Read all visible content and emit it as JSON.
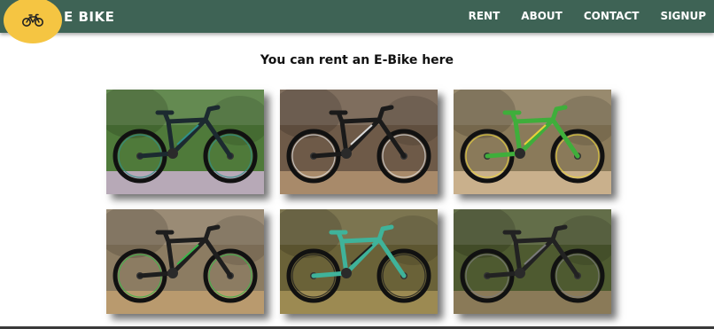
{
  "brand": {
    "name": "E BIKE",
    "logo_icon": "bicycle-icon",
    "logo_color": "#f5c542"
  },
  "nav": {
    "items": [
      {
        "label": "RENT"
      },
      {
        "label": "ABOUT"
      },
      {
        "label": "CONTACT"
      },
      {
        "label": "SIGNUP"
      }
    ],
    "background": "#3e6355"
  },
  "main": {
    "heading": "You can rent an E-Bike here"
  },
  "gallery": {
    "items": [
      {
        "name": "black-teal-mountain-bike-photo",
        "frame": "#1c2a30",
        "accent": "#2f8f8a",
        "bg": "#4f7a3a",
        "ground": "#b7a9b7"
      },
      {
        "name": "black-white-mountain-bike-photo",
        "frame": "#1a1a1a",
        "accent": "#d9d9d9",
        "bg": "#6e5a48",
        "ground": "#a88a6a"
      },
      {
        "name": "green-yellow-mountain-bike-photo",
        "frame": "#3fae3b",
        "accent": "#e8d23a",
        "bg": "#8a7a5a",
        "ground": "#c9b08c"
      },
      {
        "name": "black-green-mountain-bike-photo",
        "frame": "#1e1e1e",
        "accent": "#3bb54a",
        "bg": "#8c7c62",
        "ground": "#b99a6e"
      },
      {
        "name": "turquoise-mountain-bike-photo",
        "frame": "#3fb39a",
        "accent": "#1e1e1e",
        "bg": "#6a6238",
        "ground": "#9c8a52"
      },
      {
        "name": "black-grey-mountain-bike-photo",
        "frame": "#222222",
        "accent": "#7a7a7a",
        "bg": "#4e5a30",
        "ground": "#8a7a58"
      }
    ]
  }
}
